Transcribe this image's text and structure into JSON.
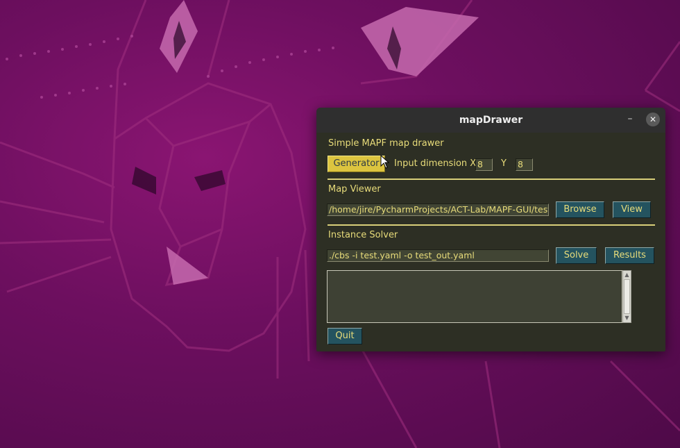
{
  "window": {
    "title": "mapDrawer",
    "minimize_glyph": "–",
    "close_glyph": "✕"
  },
  "generator_section": {
    "heading": "Simple MAPF map drawer",
    "generator_button": "Generator",
    "dimension_label_x": "Input dimension X",
    "dimension_x_value": "8",
    "dimension_label_y": "Y",
    "dimension_y_value": "8"
  },
  "map_viewer": {
    "heading": "Map Viewer",
    "path_value": "/home/jire/PycharmProjects/ACT-Lab/MAPF-GUI/test.",
    "browse_button": "Browse",
    "view_button": "View"
  },
  "instance_solver": {
    "heading": "Instance Solver",
    "command_value": "./cbs -i test.yaml -o test_out.yaml",
    "solve_button": "Solve",
    "results_button": "Results",
    "output_text": ""
  },
  "quit_button": "Quit",
  "icons": {
    "scroll_up": "scroll-up-arrow-icon",
    "scroll_down": "scroll-down-arrow-icon",
    "pointer": "mouse-pointer-icon"
  },
  "colors": {
    "desktop_bg": "#6d0f5f",
    "window_bg": "#2d2f24",
    "label_text": "#e8dc7a",
    "button_bg": "#24535f",
    "active_button_bg": "#dcc43f",
    "entry_bg": "#414534"
  }
}
